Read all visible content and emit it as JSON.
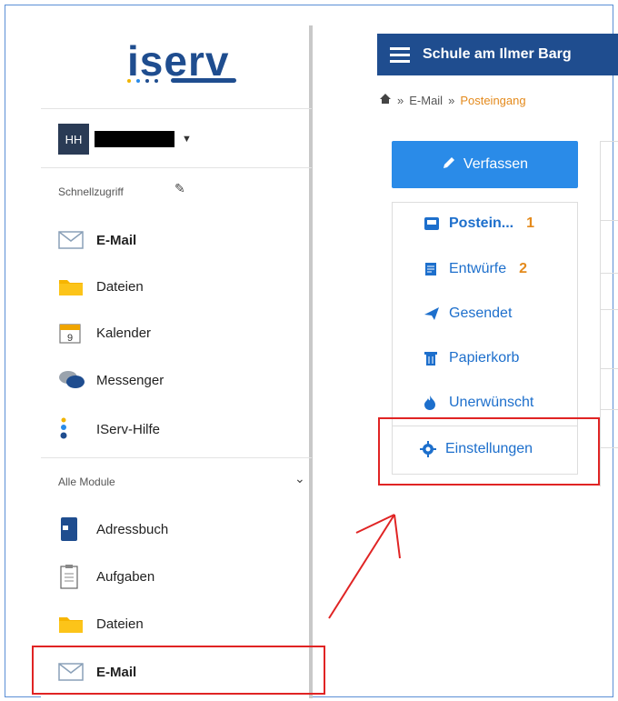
{
  "sidebar": {
    "logo": "iserv",
    "user_initials": "HH",
    "quick_access_label": "Schnellzugriff",
    "quick_items": [
      {
        "label": "E-Mail",
        "icon": "envelope-icon",
        "bold": true
      },
      {
        "label": "Dateien",
        "icon": "folder-icon"
      },
      {
        "label": "Kalender",
        "icon": "calendar-icon",
        "icon_text": "9"
      },
      {
        "label": "Messenger",
        "icon": "chat-bubbles-icon"
      },
      {
        "label": "IServ-Hilfe",
        "icon": "info-icon"
      }
    ],
    "all_modules_label": "Alle Module",
    "module_items": [
      {
        "label": "Adressbuch",
        "icon": "address-book-icon"
      },
      {
        "label": "Aufgaben",
        "icon": "clipboard-icon"
      },
      {
        "label": "Dateien",
        "icon": "folder-icon"
      },
      {
        "label": "E-Mail",
        "icon": "envelope-icon",
        "bold": true
      }
    ]
  },
  "app": {
    "school_name": "Schule am Ilmer Barg",
    "breadcrumb": {
      "home_icon": "home-icon",
      "sep": "»",
      "item1": "E-Mail",
      "item2": "Posteingang"
    },
    "compose_label": "Verfassen",
    "folders": [
      {
        "label": "Postein...",
        "icon": "inbox-icon",
        "count": "1",
        "bold": true
      },
      {
        "label": "Entwürfe",
        "icon": "drafts-icon",
        "count": "2"
      },
      {
        "label": "Gesendet",
        "icon": "send-icon"
      },
      {
        "label": "Papierkorb",
        "icon": "trash-icon"
      },
      {
        "label": "Unerwünscht",
        "icon": "fire-icon"
      }
    ],
    "settings_label": "Einstellungen"
  },
  "colors": {
    "brand": "#1f4d8f",
    "accent": "#2a8be8",
    "orange": "#e48a1c",
    "highlight": "#e02424"
  }
}
